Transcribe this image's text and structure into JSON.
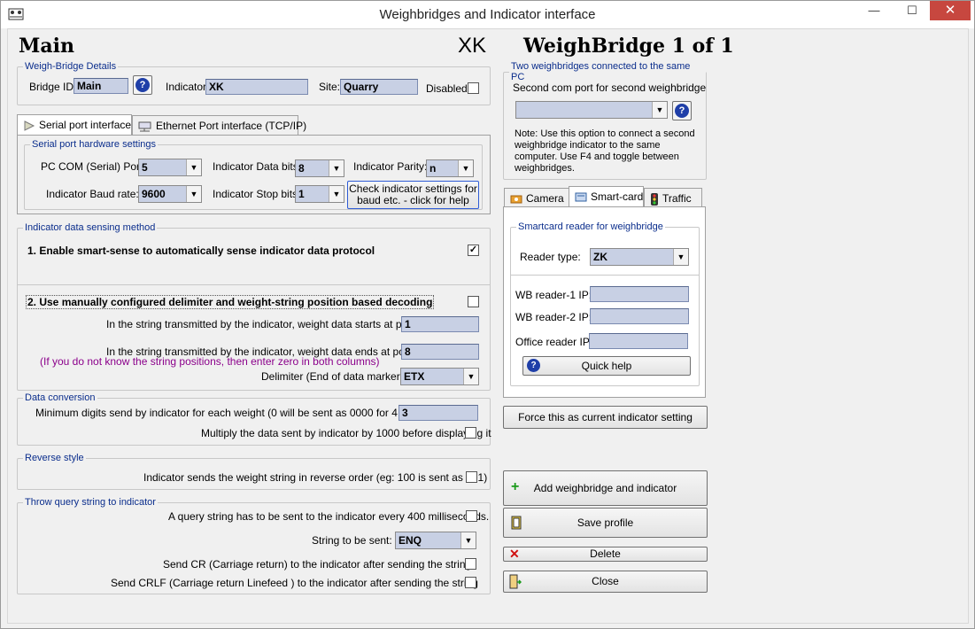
{
  "window": {
    "title": "Weighbridges and Indicator interface",
    "min": "—",
    "max": "☐",
    "close": "✕"
  },
  "header": {
    "main": "Main",
    "xk": "XK",
    "wb": "WeighBridge 1 of 1"
  },
  "details": {
    "legend": "Weigh-Bridge Details",
    "bridge_id_label": "Bridge ID",
    "bridge_id": "Main",
    "indicator_label": "Indicator",
    "indicator": "XK",
    "site_label": "Site:",
    "site": "Quarry",
    "disabled_label": "Disabled"
  },
  "tabs": {
    "serial": "Serial port interface",
    "ethernet": "Ethernet Port interface (TCP/IP)"
  },
  "serial": {
    "legend": "Serial port hardware settings",
    "com_label": "PC COM (Serial) Port:",
    "com": "5",
    "baud_label": "Indicator Baud rate:",
    "baud": "9600",
    "databits_label": "Indicator Data bits:",
    "databits": "8",
    "stopbits_label": "Indicator Stop bits:",
    "stopbits": "1",
    "parity_label": "Indicator Parity:",
    "parity": "n",
    "check_btn_1": "Check indicator settings for",
    "check_btn_2": "baud etc. - click for help"
  },
  "sensing": {
    "legend": "Indicator data sensing method",
    "opt1": "1. Enable smart-sense to automatically sense indicator data protocol",
    "opt1_checked": "✓",
    "opt2": "2. Use manually configured delimiter and weight-string position based decoding",
    "start_label": "In the string transmitted by the indicator, weight data starts at position",
    "start": "1",
    "end_label": "In the string transmitted by the indicator, weight data ends at position",
    "end": "8",
    "hint": "(If you do not know the string positions, then enter zero in both columns)",
    "delim_label": "Delimiter (End of data marker):",
    "delim": "ETX"
  },
  "conversion": {
    "legend": "Data conversion",
    "min_label": "Minimum digits send by indicator for each weight (0 will be sent as 0000 for 4 digits)",
    "min": "3",
    "mult_label": "Multiply the data sent by  indicator by 1000 before displaying it"
  },
  "reverse": {
    "legend": "Reverse style",
    "label": "Indicator sends the weight string in reverse order (eg: 100 is sent as 001)"
  },
  "query": {
    "legend": "Throw query string to indicator",
    "every_label": "A query string has to be sent to the indicator every 400 milliseconds.",
    "string_label": "String to be sent:",
    "string": "ENQ",
    "cr_label": "Send CR (Carriage return) to the indicator after sending the string",
    "crlf_label": "Send CRLF (Carriage return Linefeed ) to the indicator after sending the string"
  },
  "two": {
    "legend": "Two weighbridges connected to the same PC",
    "second_label": "Second com port for second weighbridge",
    "second": "",
    "note": "Note: Use this option to connect a second weighbridge indicator to the same computer. Use F4 and toggle between weighbridges."
  },
  "righttabs": {
    "camera": "Camera",
    "smartcard": "Smart-card",
    "traffic": "Traffic"
  },
  "smartcard": {
    "legend": "Smartcard reader for weighbridge",
    "type_label": "Reader type:",
    "type": "ZK",
    "r1_label": "WB reader-1 IP:",
    "r2_label": "WB reader-2 IP:",
    "office_label": "Office reader IP:",
    "quick_help": "Quick help"
  },
  "buttons": {
    "force": "Force this as current indicator setting",
    "add": "Add weighbridge and indicator",
    "save": "Save profile",
    "delete": "Delete",
    "close": "Close"
  }
}
